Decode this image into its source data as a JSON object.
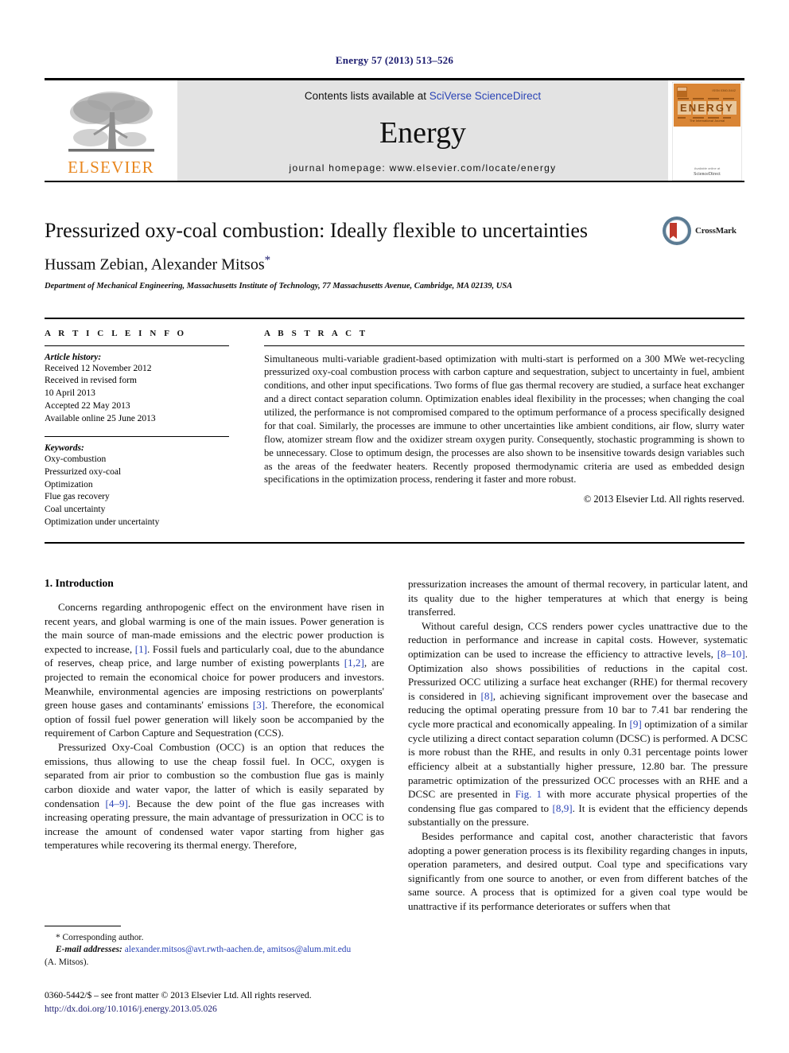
{
  "running_head": "Energy 57 (2013) 513–526",
  "masthead": {
    "publisher_name": "ELSEVIER",
    "contents_prefix": "Contents lists available at ",
    "contents_link": "SciVerse ScienceDirect",
    "journal_name": "Energy",
    "homepage": "journal homepage: www.elsevier.com/locate/energy",
    "cover_title": "ENERGY",
    "cover_subtitle": "The International Journal"
  },
  "article": {
    "title": "Pressurized oxy-coal combustion: Ideally flexible to uncertainties",
    "authors": "Hussam Zebian, Alexander Mitsos",
    "corresponding_marker": "*",
    "affiliation": "Department of Mechanical Engineering, Massachusetts Institute of Technology, 77 Massachusetts Avenue, Cambridge, MA 02139, USA",
    "crossmark_label": "CrossMark"
  },
  "info": {
    "label": "A R T I C L E   I N F O",
    "history_heading": "Article history:",
    "history": [
      "Received 12 November 2012",
      "Received in revised form",
      "10 April 2013",
      "Accepted 22 May 2013",
      "Available online 25 June 2013"
    ],
    "keywords_heading": "Keywords:",
    "keywords": [
      "Oxy-combustion",
      "Pressurized oxy-coal",
      "Optimization",
      "Flue gas recovery",
      "Coal uncertainty",
      "Optimization under uncertainty"
    ]
  },
  "abstract": {
    "label": "A B S T R A C T",
    "text": "Simultaneous multi-variable gradient-based optimization with multi-start is performed on a 300 MWe wet-recycling pressurized oxy-coal combustion process with carbon capture and sequestration, subject to uncertainty in fuel, ambient conditions, and other input specifications. Two forms of flue gas thermal recovery are studied, a surface heat exchanger and a direct contact separation column. Optimization enables ideal flexibility in the processes; when changing the coal utilized, the performance is not compromised compared to the optimum performance of a process specifically designed for that coal. Similarly, the processes are immune to other uncertainties like ambient conditions, air flow, slurry water flow, atomizer stream flow and the oxidizer stream oxygen purity. Consequently, stochastic programming is shown to be unnecessary. Close to optimum design, the processes are also shown to be insensitive towards design variables such as the areas of the feedwater heaters. Recently proposed thermodynamic criteria are used as embedded design specifications in the optimization process, rendering it faster and more robust.",
    "copyright": "© 2013 Elsevier Ltd. All rights reserved."
  },
  "body": {
    "section_heading": "1. Introduction",
    "left_paragraphs": [
      "Concerns regarding anthropogenic effect on the environment have risen in recent years, and global warming is one of the main issues. Power generation is the main source of man-made emissions and the electric power production is expected to increase, [1]. Fossil fuels and particularly coal, due to the abundance of reserves, cheap price, and large number of existing powerplants [1,2], are projected to remain the economical choice for power producers and investors. Meanwhile, environmental agencies are imposing restrictions on powerplants' green house gases and contaminants' emissions [3]. Therefore, the economical option of fossil fuel power generation will likely soon be accompanied by the requirement of Carbon Capture and Sequestration (CCS).",
      "Pressurized Oxy-Coal Combustion (OCC) is an option that reduces the emissions, thus allowing to use the cheap fossil fuel. In OCC, oxygen is separated from air prior to combustion so the combustion flue gas is mainly carbon dioxide and water vapor, the latter of which is easily separated by condensation [4–9]. Because the dew point of the flue gas increases with increasing operating pressure, the main advantage of pressurization in OCC is to increase the amount of condensed water vapor starting from higher gas temperatures while recovering its thermal energy. Therefore,"
    ],
    "right_paragraphs": [
      "pressurization increases the amount of thermal recovery, in particular latent, and its quality due to the higher temperatures at which that energy is being transferred.",
      "Without careful design, CCS renders power cycles unattractive due to the reduction in performance and increase in capital costs. However, systematic optimization can be used to increase the efficiency to attractive levels, [8–10]. Optimization also shows possibilities of reductions in the capital cost. Pressurized OCC utilizing a surface heat exchanger (RHE) for thermal recovery is considered in [8], achieving significant improvement over the basecase and reducing the optimal operating pressure from 10 bar to 7.41 bar rendering the cycle more practical and economically appealing. In [9] optimization of a similar cycle utilizing a direct contact separation column (DCSC) is performed. A DCSC is more robust than the RHE, and results in only 0.31 percentage points lower efficiency albeit at a substantially higher pressure, 12.80 bar. The pressure parametric optimization of the pressurized OCC processes with an RHE and a DCSC are presented in Fig. 1 with more accurate physical properties of the condensing flue gas compared to [8,9]. It is evident that the efficiency depends substantially on the pressure.",
      "Besides performance and capital cost, another characteristic that favors adopting a power generation process is its flexibility regarding changes in inputs, operation parameters, and desired output. Coal type and specifications vary significantly from one source to another, or even from different batches of the same source. A process that is optimized for a given coal type would be unattractive if its performance deteriorates or suffers when that"
    ]
  },
  "footnotes": {
    "corresponding": "* Corresponding author.",
    "email_label": "E-mail addresses:",
    "emails": "alexander.mitsos@avt.rwth-aachen.de, amitsos@alum.mit.edu",
    "author_ref": "(A. Mitsos).",
    "issn_line": "0360-5442/$ – see front matter © 2013 Elsevier Ltd. All rights reserved.",
    "doi": "http://dx.doi.org/10.1016/j.energy.2013.05.026"
  },
  "colors": {
    "link_blue": "#2b44b6",
    "header_navy": "#1a1a6e",
    "elsevier_orange": "#E8861E",
    "masthead_grey": "#e3e3e3"
  }
}
